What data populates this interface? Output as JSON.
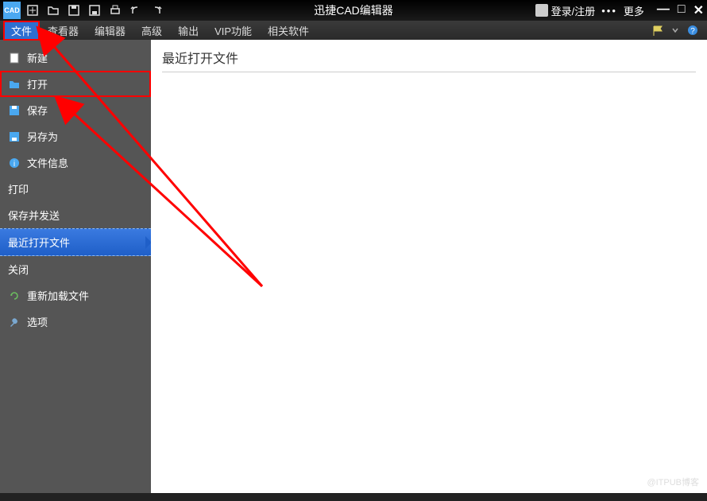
{
  "titlebar": {
    "app_icon_text": "CAD",
    "title": "迅捷CAD编辑器",
    "login_label": "登录/注册",
    "more_label": "更多"
  },
  "menubar": {
    "items": [
      "文件",
      "查看器",
      "编辑器",
      "高级",
      "输出",
      "VIP功能",
      "相关软件"
    ]
  },
  "file_menu": {
    "items": [
      {
        "icon": "new",
        "label": "新建"
      },
      {
        "icon": "open",
        "label": "打开"
      },
      {
        "icon": "save",
        "label": "保存"
      },
      {
        "icon": "saveas",
        "label": "另存为"
      },
      {
        "icon": "info",
        "label": "文件信息"
      },
      {
        "icon": "",
        "label": "打印"
      },
      {
        "icon": "",
        "label": "保存并发送"
      },
      {
        "icon": "",
        "label": "最近打开文件"
      },
      {
        "icon": "",
        "label": "关闭"
      },
      {
        "icon": "reload",
        "label": "重新加载文件"
      },
      {
        "icon": "options",
        "label": "选项"
      }
    ]
  },
  "content": {
    "title": "最近打开文件",
    "watermark": "@ITPUB博客"
  }
}
